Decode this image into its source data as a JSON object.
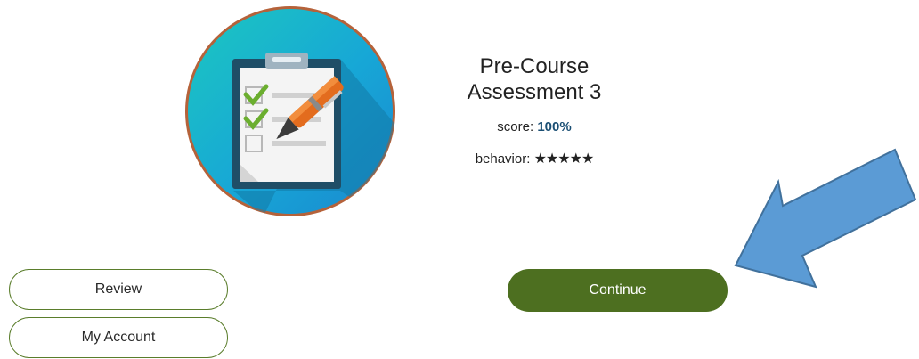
{
  "assessment": {
    "title_line1": "Pre-Course",
    "title_line2": "Assessment 3",
    "score_label": "score:",
    "score_value": "100%",
    "behavior_label": "behavior:",
    "behavior_stars": "★★★★★",
    "behavior_rating": 5,
    "behavior_max": 5
  },
  "buttons": {
    "review": "Review",
    "my_account": "My Account",
    "continue": "Continue"
  },
  "icons": {
    "badge": "clipboard-checklist-icon",
    "arrow": "callout-arrow"
  },
  "colors": {
    "accent_green": "#4d6f20",
    "badge_ring": "#b5623a",
    "badge_fill": "#1aa6d8",
    "score_value": "#1b4f74",
    "arrow_fill": "#5b9bd5"
  }
}
